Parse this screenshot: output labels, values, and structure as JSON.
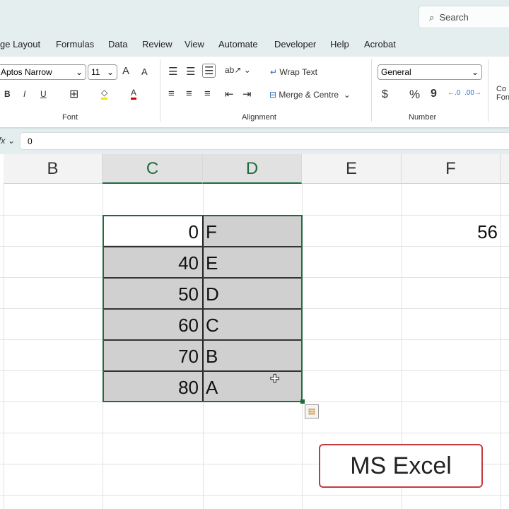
{
  "search": {
    "placeholder": "Search",
    "icon": "search-icon"
  },
  "tabs": [
    "ge Layout",
    "Formulas",
    "Data",
    "Review",
    "View",
    "Automate",
    "Developer",
    "Help",
    "Acrobat"
  ],
  "font": {
    "name": "Aptos Narrow",
    "size": "11",
    "group": "Font",
    "bold": "B",
    "italic": "I",
    "underline": "U",
    "color_letter": "A",
    "grow": "A",
    "shrink": "A"
  },
  "alignment": {
    "wrap": "Wrap Text",
    "merge": "Merge & Centre",
    "group": "Alignment"
  },
  "number": {
    "format": "General",
    "currency": "$",
    "percent": "%",
    "comma": "9",
    "group": "Number"
  },
  "styles": {
    "cond_line1": "Co",
    "cond_line2": "Forr"
  },
  "formula_bar": {
    "fx": "fx",
    "value": "0"
  },
  "columns": [
    "B",
    "C",
    "D",
    "E",
    "F"
  ],
  "cells": {
    "C": [
      "0",
      "40",
      "50",
      "60",
      "70",
      "80"
    ],
    "D": [
      "F",
      "E",
      "D",
      "C",
      "B",
      "A"
    ],
    "F4": "56"
  },
  "overlay": {
    "label": "MS Excel"
  },
  "colors": {
    "accent": "#1e6b40",
    "selection": "#d0d0d0",
    "overlay_border": "#c43b3f"
  }
}
